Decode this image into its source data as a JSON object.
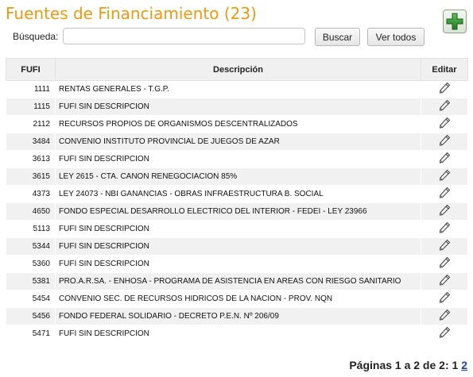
{
  "page": {
    "title": "Fuentes de Financiamiento (23)"
  },
  "search": {
    "label": "Búsqueda:",
    "value": "",
    "placeholder": ""
  },
  "buttons": {
    "search": "Buscar",
    "view_all": "Ver todos",
    "add_icon": "plus-icon"
  },
  "table": {
    "headers": [
      "FUFI",
      "Descripción",
      "Editar"
    ],
    "edit_icon": "pencil-icon",
    "rows": [
      {
        "fufi": "1111",
        "desc": "RENTAS GENERALES - T.G.P."
      },
      {
        "fufi": "1115",
        "desc": "FUFI SIN DESCRIPCION"
      },
      {
        "fufi": "2112",
        "desc": "RECURSOS PROPIOS DE ORGANISMOS DESCENTRALIZADOS"
      },
      {
        "fufi": "3484",
        "desc": "CONVENIO INSTITUTO PROVINCIAL DE JUEGOS DE AZAR"
      },
      {
        "fufi": "3613",
        "desc": "FUFI SIN DESCRIPCION"
      },
      {
        "fufi": "3615",
        "desc": "LEY 2615 - CTA. CANON RENEGOCIACION 85%"
      },
      {
        "fufi": "4373",
        "desc": "LEY 24073 - NBI GANANCIAS - OBRAS INFRAESTRUCTURA B. SOCIAL"
      },
      {
        "fufi": "4650",
        "desc": "FONDO ESPECIAL DESARROLLO ELECTRICO DEL INTERIOR - FEDEI - LEY 23966"
      },
      {
        "fufi": "5113",
        "desc": "FUFI SIN DESCRIPCION"
      },
      {
        "fufi": "5344",
        "desc": "FUFI SIN DESCRIPCION"
      },
      {
        "fufi": "5360",
        "desc": "FUFI SIN DESCRIPCION"
      },
      {
        "fufi": "5381",
        "desc": "PRO.A.R.SA. - ENHOSA - PROGRAMA DE ASISTENCIA EN AREAS CON RIESGO SANITARIO"
      },
      {
        "fufi": "5454",
        "desc": "CONVENIO SEC. DE RECURSOS HIDRICOS DE LA NACION - PROV. NQN"
      },
      {
        "fufi": "5456",
        "desc": "FONDO FEDERAL SOLIDARIO - DECRETO P.E.N. Nº 206/09"
      },
      {
        "fufi": "5471",
        "desc": "FUFI SIN DESCRIPCION"
      }
    ]
  },
  "pagination": {
    "label": "Páginas 1 a 2 de 2:",
    "current": "1",
    "next": "2"
  },
  "colors": {
    "title": "#f0980f",
    "add_button": "#2e8b2e",
    "link": "#1a3fb0"
  }
}
